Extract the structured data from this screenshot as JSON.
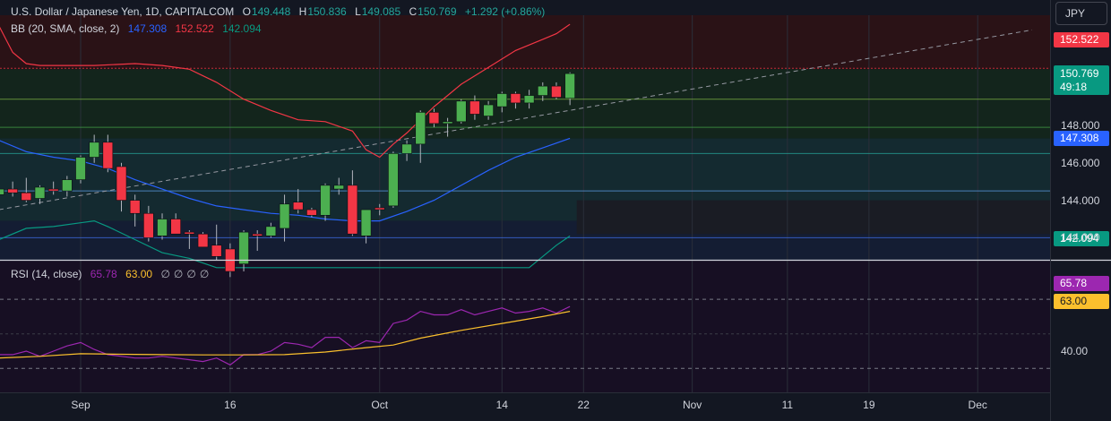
{
  "header": {
    "symbol": "U.S. Dollar / Japanese Yen, 1D, CAPITALCOM",
    "ohlc": [
      {
        "label": "O",
        "value": "149.448"
      },
      {
        "label": "H",
        "value": "150.836"
      },
      {
        "label": "L",
        "value": "149.085"
      },
      {
        "label": "C",
        "value": "150.769"
      }
    ],
    "change": "+1.292 (+0.86%)"
  },
  "bb_legend": {
    "label": "BB (20, SMA, close, 2)",
    "mid": "147.308",
    "upper": "152.522",
    "lower": "142.094"
  },
  "rsi_legend": {
    "label": "RSI (14, close)",
    "rsi": "65.78",
    "ma": "63.00",
    "na": [
      "∅",
      "∅",
      "∅",
      "∅"
    ]
  },
  "currency_button": "JPY",
  "price_tags": {
    "upper": "152.522",
    "last": "150.769",
    "countdown": "49:18",
    "mid": "147.308",
    "lower": "142.094",
    "rsi": "65.78",
    "rsi_ma": "63.00"
  },
  "colors": {
    "background": "#131722",
    "up": "#4caf50",
    "down": "#f23645",
    "bb_upper": "#f23645",
    "bb_mid": "#2962ff",
    "bb_lower": "#089981",
    "rsi": "#9c27b0",
    "rsi_ma": "#fbc02d"
  },
  "chart_data": [
    {
      "type": "candlestick",
      "title": "U.S. Dollar / Japanese Yen, 1D, CAPITALCOM",
      "ylim": [
        141,
        153.5
      ],
      "price_ticks": [
        148.0,
        146.0,
        144.0,
        142.0
      ],
      "price_tick_labels": [
        "148.000",
        "146.000",
        "144.000",
        "144.000"
      ],
      "x_labels": [
        {
          "label": "Sep",
          "day": 0
        },
        {
          "label": "16",
          "day": 11
        },
        {
          "label": "Oct",
          "day": 22
        },
        {
          "label": "14",
          "day": 31
        },
        {
          "label": "22",
          "day": 37
        },
        {
          "label": "Nov",
          "day": 45
        },
        {
          "label": "11",
          "day": 52
        },
        {
          "label": "19",
          "day": 58
        },
        {
          "label": "Dec",
          "day": 66
        }
      ],
      "candles": [
        {
          "day": -6,
          "o": 144.3,
          "h": 144.8,
          "l": 143.8,
          "c": 144.6
        },
        {
          "day": -5,
          "o": 144.6,
          "h": 145.0,
          "l": 144.2,
          "c": 144.4
        },
        {
          "day": -4,
          "o": 144.4,
          "h": 145.2,
          "l": 143.9,
          "c": 144.0
        },
        {
          "day": -3,
          "o": 144.1,
          "h": 144.8,
          "l": 143.8,
          "c": 144.7
        },
        {
          "day": -2,
          "o": 144.6,
          "h": 145.0,
          "l": 144.3,
          "c": 144.5
        },
        {
          "day": -1,
          "o": 144.5,
          "h": 145.3,
          "l": 144.2,
          "c": 145.1
        },
        {
          "day": 0,
          "o": 145.1,
          "h": 146.4,
          "l": 144.9,
          "c": 146.3
        },
        {
          "day": 1,
          "o": 146.3,
          "h": 147.5,
          "l": 146.0,
          "c": 147.1
        },
        {
          "day": 2,
          "o": 147.1,
          "h": 147.5,
          "l": 145.5,
          "c": 145.7
        },
        {
          "day": 3,
          "o": 145.8,
          "h": 146.0,
          "l": 143.4,
          "c": 144.0
        },
        {
          "day": 4,
          "o": 144.0,
          "h": 144.3,
          "l": 142.6,
          "c": 143.3
        },
        {
          "day": 5,
          "o": 143.3,
          "h": 143.7,
          "l": 141.8,
          "c": 142.0
        },
        {
          "day": 6,
          "o": 142.1,
          "h": 143.3,
          "l": 141.9,
          "c": 143.0
        },
        {
          "day": 7,
          "o": 143.0,
          "h": 143.3,
          "l": 142.2,
          "c": 142.2
        },
        {
          "day": 8,
          "o": 142.3,
          "h": 142.4,
          "l": 141.4,
          "c": 142.2
        },
        {
          "day": 9,
          "o": 142.2,
          "h": 142.3,
          "l": 141.5,
          "c": 141.5
        },
        {
          "day": 10,
          "o": 141.6,
          "h": 142.7,
          "l": 140.8,
          "c": 141.0
        },
        {
          "day": 11,
          "o": 141.4,
          "h": 141.7,
          "l": 139.9,
          "c": 140.2
        },
        {
          "day": 12,
          "o": 140.6,
          "h": 142.4,
          "l": 140.2,
          "c": 142.3
        },
        {
          "day": 13,
          "o": 142.2,
          "h": 142.4,
          "l": 141.3,
          "c": 142.1
        },
        {
          "day": 14,
          "o": 142.1,
          "h": 142.8,
          "l": 142.0,
          "c": 142.6
        },
        {
          "day": 15,
          "o": 142.5,
          "h": 144.3,
          "l": 141.8,
          "c": 143.8
        },
        {
          "day": 16,
          "o": 143.9,
          "h": 144.6,
          "l": 143.3,
          "c": 143.5
        },
        {
          "day": 17,
          "o": 143.5,
          "h": 143.6,
          "l": 143.1,
          "c": 143.2
        },
        {
          "day": 18,
          "o": 143.2,
          "h": 144.9,
          "l": 142.9,
          "c": 144.8
        },
        {
          "day": 19,
          "o": 144.6,
          "h": 145.2,
          "l": 144.3,
          "c": 144.8
        },
        {
          "day": 20,
          "o": 144.8,
          "h": 145.6,
          "l": 142.1,
          "c": 142.2
        },
        {
          "day": 21,
          "o": 142.1,
          "h": 143.4,
          "l": 141.7,
          "c": 143.5
        },
        {
          "day": 22,
          "o": 143.6,
          "h": 143.8,
          "l": 143.2,
          "c": 143.5
        },
        {
          "day": 23,
          "o": 143.7,
          "h": 146.6,
          "l": 143.6,
          "c": 146.5
        },
        {
          "day": 24,
          "o": 146.5,
          "h": 147.2,
          "l": 146.1,
          "c": 147.0
        },
        {
          "day": 25,
          "o": 147.0,
          "h": 148.8,
          "l": 146.0,
          "c": 148.7
        },
        {
          "day": 26,
          "o": 148.7,
          "h": 148.9,
          "l": 147.9,
          "c": 148.1
        },
        {
          "day": 27,
          "o": 148.1,
          "h": 148.4,
          "l": 147.4,
          "c": 148.2
        },
        {
          "day": 28,
          "o": 148.2,
          "h": 149.4,
          "l": 148.1,
          "c": 149.3
        },
        {
          "day": 29,
          "o": 149.3,
          "h": 149.6,
          "l": 148.3,
          "c": 148.6
        },
        {
          "day": 30,
          "o": 148.5,
          "h": 149.3,
          "l": 148.3,
          "c": 149.1
        },
        {
          "day": 31,
          "o": 149.0,
          "h": 149.8,
          "l": 148.7,
          "c": 149.7
        },
        {
          "day": 32,
          "o": 149.7,
          "h": 149.8,
          "l": 148.9,
          "c": 149.2
        },
        {
          "day": 33,
          "o": 149.2,
          "h": 149.9,
          "l": 148.9,
          "c": 149.6
        },
        {
          "day": 34,
          "o": 149.6,
          "h": 150.3,
          "l": 149.3,
          "c": 150.1
        },
        {
          "day": 35,
          "o": 150.1,
          "h": 150.3,
          "l": 149.4,
          "c": 149.5
        },
        {
          "day": 36,
          "o": 149.448,
          "h": 150.836,
          "l": 149.085,
          "c": 150.769
        }
      ],
      "bb_upper": [
        {
          "day": -6,
          "v": 153.3
        },
        {
          "day": -5,
          "v": 151.9
        },
        {
          "day": -4,
          "v": 151.3
        },
        {
          "day": -3,
          "v": 151.2
        },
        {
          "day": -1,
          "v": 151.2
        },
        {
          "day": 1,
          "v": 151.2
        },
        {
          "day": 4,
          "v": 151.3
        },
        {
          "day": 6,
          "v": 151.2
        },
        {
          "day": 8,
          "v": 151.0
        },
        {
          "day": 10,
          "v": 150.3
        },
        {
          "day": 12,
          "v": 149.4
        },
        {
          "day": 14,
          "v": 148.8
        },
        {
          "day": 16,
          "v": 148.3
        },
        {
          "day": 18,
          "v": 148.2
        },
        {
          "day": 20,
          "v": 147.7
        },
        {
          "day": 21,
          "v": 146.7
        },
        {
          "day": 22,
          "v": 146.3
        },
        {
          "day": 23,
          "v": 147.0
        },
        {
          "day": 24,
          "v": 147.6
        },
        {
          "day": 25,
          "v": 148.3
        },
        {
          "day": 26,
          "v": 149.0
        },
        {
          "day": 27,
          "v": 149.6
        },
        {
          "day": 28,
          "v": 150.2
        },
        {
          "day": 30,
          "v": 151.1
        },
        {
          "day": 32,
          "v": 152.0
        },
        {
          "day": 34,
          "v": 152.6
        },
        {
          "day": 35,
          "v": 152.9
        },
        {
          "day": 36,
          "v": 153.4
        }
      ],
      "bb_mid": [
        {
          "day": -6,
          "v": 147.2
        },
        {
          "day": -4,
          "v": 146.6
        },
        {
          "day": -2,
          "v": 146.3
        },
        {
          "day": 0,
          "v": 146.1
        },
        {
          "day": 2,
          "v": 145.7
        },
        {
          "day": 4,
          "v": 145.1
        },
        {
          "day": 6,
          "v": 144.6
        },
        {
          "day": 8,
          "v": 144.1
        },
        {
          "day": 10,
          "v": 143.7
        },
        {
          "day": 12,
          "v": 143.5
        },
        {
          "day": 14,
          "v": 143.3
        },
        {
          "day": 16,
          "v": 143.2
        },
        {
          "day": 18,
          "v": 143.0
        },
        {
          "day": 20,
          "v": 142.9
        },
        {
          "day": 22,
          "v": 142.9
        },
        {
          "day": 24,
          "v": 143.4
        },
        {
          "day": 26,
          "v": 144.0
        },
        {
          "day": 28,
          "v": 144.8
        },
        {
          "day": 30,
          "v": 145.6
        },
        {
          "day": 32,
          "v": 146.3
        },
        {
          "day": 34,
          "v": 146.8
        },
        {
          "day": 36,
          "v": 147.308
        }
      ],
      "bb_lower": [
        {
          "day": -6,
          "v": 141.9
        },
        {
          "day": -4,
          "v": 142.5
        },
        {
          "day": -2,
          "v": 142.6
        },
        {
          "day": 0,
          "v": 142.8
        },
        {
          "day": 1,
          "v": 142.9
        },
        {
          "day": 2,
          "v": 142.6
        },
        {
          "day": 4,
          "v": 141.9
        },
        {
          "day": 6,
          "v": 141.2
        },
        {
          "day": 8,
          "v": 140.9
        },
        {
          "day": 10,
          "v": 140.4
        },
        {
          "day": 33,
          "v": 140.4
        },
        {
          "day": 34,
          "v": 141.0
        },
        {
          "day": 35,
          "v": 141.6
        },
        {
          "day": 36,
          "v": 142.094
        }
      ],
      "trendline": [
        {
          "day": -6,
          "v": 143.5
        },
        {
          "day": 70,
          "v": 153.1
        }
      ]
    },
    {
      "type": "line",
      "title": "RSI (14, close)",
      "ylim": [
        25,
        80
      ],
      "ticks": [
        40
      ],
      "tick_labels": [
        "40.00"
      ],
      "bands": [
        70,
        30
      ],
      "series": [
        {
          "name": "RSI",
          "values": [
            {
              "day": -6,
              "v": 38
            },
            {
              "day": -5,
              "v": 38
            },
            {
              "day": -4,
              "v": 40
            },
            {
              "day": -3,
              "v": 37
            },
            {
              "day": -2,
              "v": 40
            },
            {
              "day": -1,
              "v": 43
            },
            {
              "day": 0,
              "v": 45
            },
            {
              "day": 1,
              "v": 41
            },
            {
              "day": 2,
              "v": 38
            },
            {
              "day": 3,
              "v": 37
            },
            {
              "day": 4,
              "v": 36
            },
            {
              "day": 5,
              "v": 36
            },
            {
              "day": 6,
              "v": 37
            },
            {
              "day": 7,
              "v": 36
            },
            {
              "day": 8,
              "v": 35
            },
            {
              "day": 9,
              "v": 34
            },
            {
              "day": 10,
              "v": 36
            },
            {
              "day": 11,
              "v": 32
            },
            {
              "day": 12,
              "v": 38
            },
            {
              "day": 13,
              "v": 38
            },
            {
              "day": 14,
              "v": 40
            },
            {
              "day": 15,
              "v": 45
            },
            {
              "day": 16,
              "v": 44
            },
            {
              "day": 17,
              "v": 42
            },
            {
              "day": 18,
              "v": 48
            },
            {
              "day": 19,
              "v": 48
            },
            {
              "day": 20,
              "v": 42
            },
            {
              "day": 21,
              "v": 46
            },
            {
              "day": 22,
              "v": 45
            },
            {
              "day": 23,
              "v": 56
            },
            {
              "day": 24,
              "v": 58
            },
            {
              "day": 25,
              "v": 63
            },
            {
              "day": 26,
              "v": 61
            },
            {
              "day": 27,
              "v": 61
            },
            {
              "day": 28,
              "v": 64
            },
            {
              "day": 29,
              "v": 61
            },
            {
              "day": 30,
              "v": 63
            },
            {
              "day": 31,
              "v": 65
            },
            {
              "day": 32,
              "v": 62
            },
            {
              "day": 33,
              "v": 63
            },
            {
              "day": 34,
              "v": 65
            },
            {
              "day": 35,
              "v": 62
            },
            {
              "day": 36,
              "v": 65.78
            }
          ]
        },
        {
          "name": "RSI-based MA",
          "values": [
            {
              "day": -6,
              "v": 36
            },
            {
              "day": -3,
              "v": 37
            },
            {
              "day": 0,
              "v": 38.5
            },
            {
              "day": 3,
              "v": 38.2
            },
            {
              "day": 6,
              "v": 38
            },
            {
              "day": 9,
              "v": 37.8
            },
            {
              "day": 12,
              "v": 37.8
            },
            {
              "day": 15,
              "v": 38
            },
            {
              "day": 18,
              "v": 39.5
            },
            {
              "day": 21,
              "v": 42
            },
            {
              "day": 23,
              "v": 43.5
            },
            {
              "day": 25,
              "v": 47.5
            },
            {
              "day": 28,
              "v": 52
            },
            {
              "day": 31,
              "v": 56
            },
            {
              "day": 34,
              "v": 60
            },
            {
              "day": 36,
              "v": 63.0
            }
          ]
        }
      ]
    }
  ]
}
